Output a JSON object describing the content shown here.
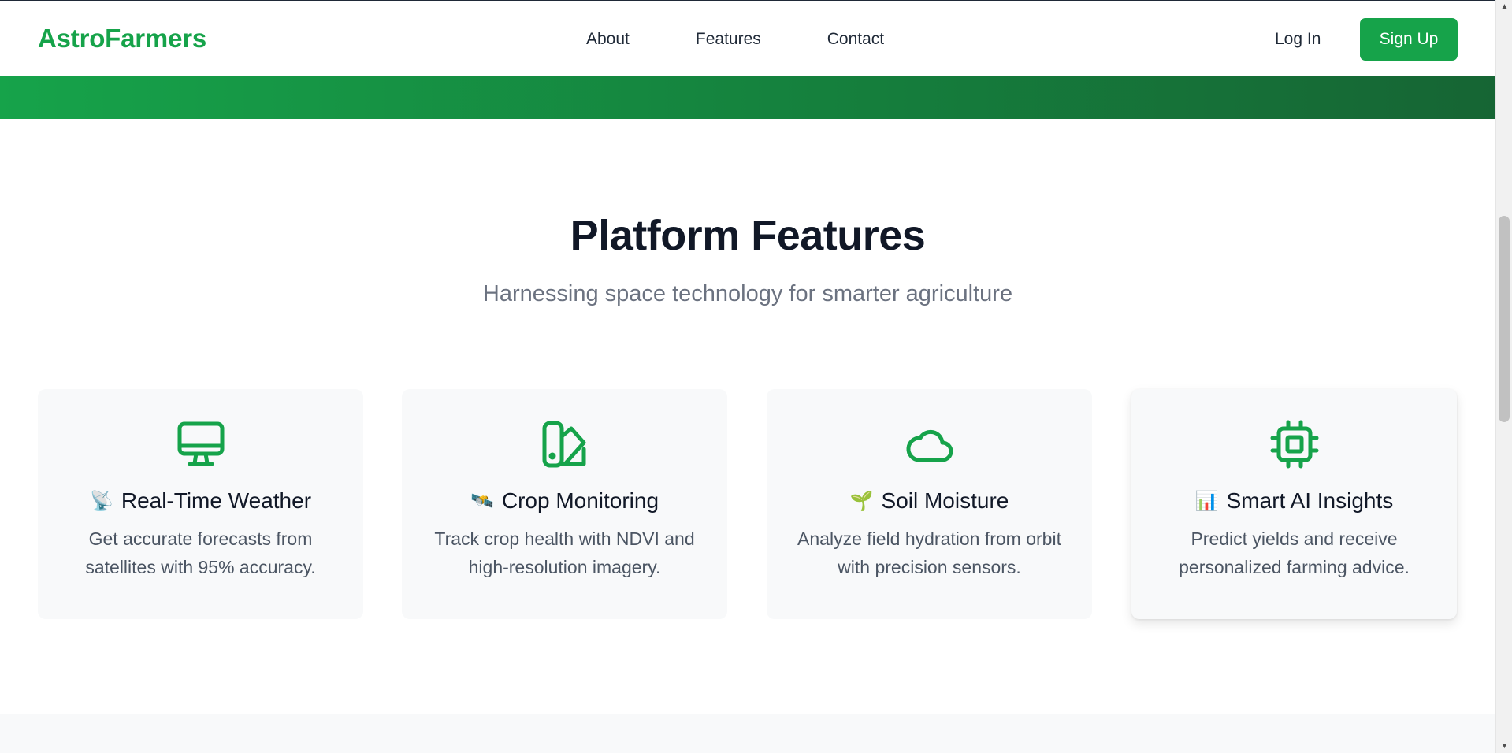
{
  "nav": {
    "brand": "AstroFarmers",
    "links": [
      "About",
      "Features",
      "Contact"
    ],
    "login": "Log In",
    "signup": "Sign Up"
  },
  "features": {
    "title": "Platform Features",
    "subtitle": "Harnessing space technology for smarter agriculture",
    "cards": [
      {
        "icon": "monitor-icon",
        "emoji": "📡",
        "title": "Real-Time Weather",
        "desc": "Get accurate forecasts from satellites with 95% accuracy."
      },
      {
        "icon": "swatch-icon",
        "emoji": "🛰️",
        "title": "Crop Monitoring",
        "desc": "Track crop health with NDVI and high-resolution imagery."
      },
      {
        "icon": "cloud-icon",
        "emoji": "🌱",
        "title": "Soil Moisture",
        "desc": "Analyze field hydration from orbit with precision sensors."
      },
      {
        "icon": "cpu-chip-icon",
        "emoji": "📊",
        "title": "Smart AI Insights",
        "desc": "Predict yields and receive personalized farming advice."
      }
    ]
  },
  "colors": {
    "brand": "#16a34a",
    "brand_dark": "#166534",
    "card_bg": "#f8f9fa",
    "heading": "#111827",
    "muted": "#6b7280"
  },
  "scrollbar": {
    "up_arrow": "▲",
    "down_arrow": "▼"
  }
}
